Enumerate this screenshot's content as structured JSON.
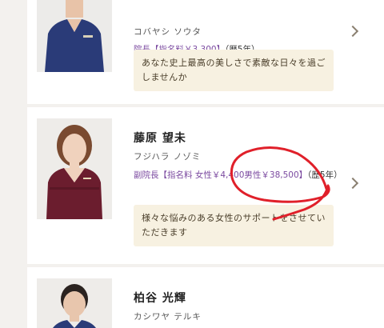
{
  "doctors": [
    {
      "name": "",
      "kana": "コバヤシ ソウタ",
      "role": "院長",
      "fee": "【指名料￥3,300】",
      "years": "（歴5年）",
      "message": "あなた史上最高の美しさで素敵な日々を過ごしませんか"
    },
    {
      "name": "藤原 望未",
      "kana": "フジハラ ノゾミ",
      "role": "副院長",
      "fee": "【指名料 女性￥4,400男性￥38,500】",
      "years": "（歴5年）",
      "message": "様々な悩みのある女性のサポートをさせていただきます"
    },
    {
      "name": "柏谷 光輝",
      "kana": "カシワヤ テルキ"
    }
  ],
  "colors": {
    "role_accent": "#7b4aa0",
    "message_bg": "#f7f1e1",
    "annotation_red": "#e0202a",
    "scrubs_navy": "#2a3b78",
    "scrubs_burgundy": "#6b1d2e"
  }
}
